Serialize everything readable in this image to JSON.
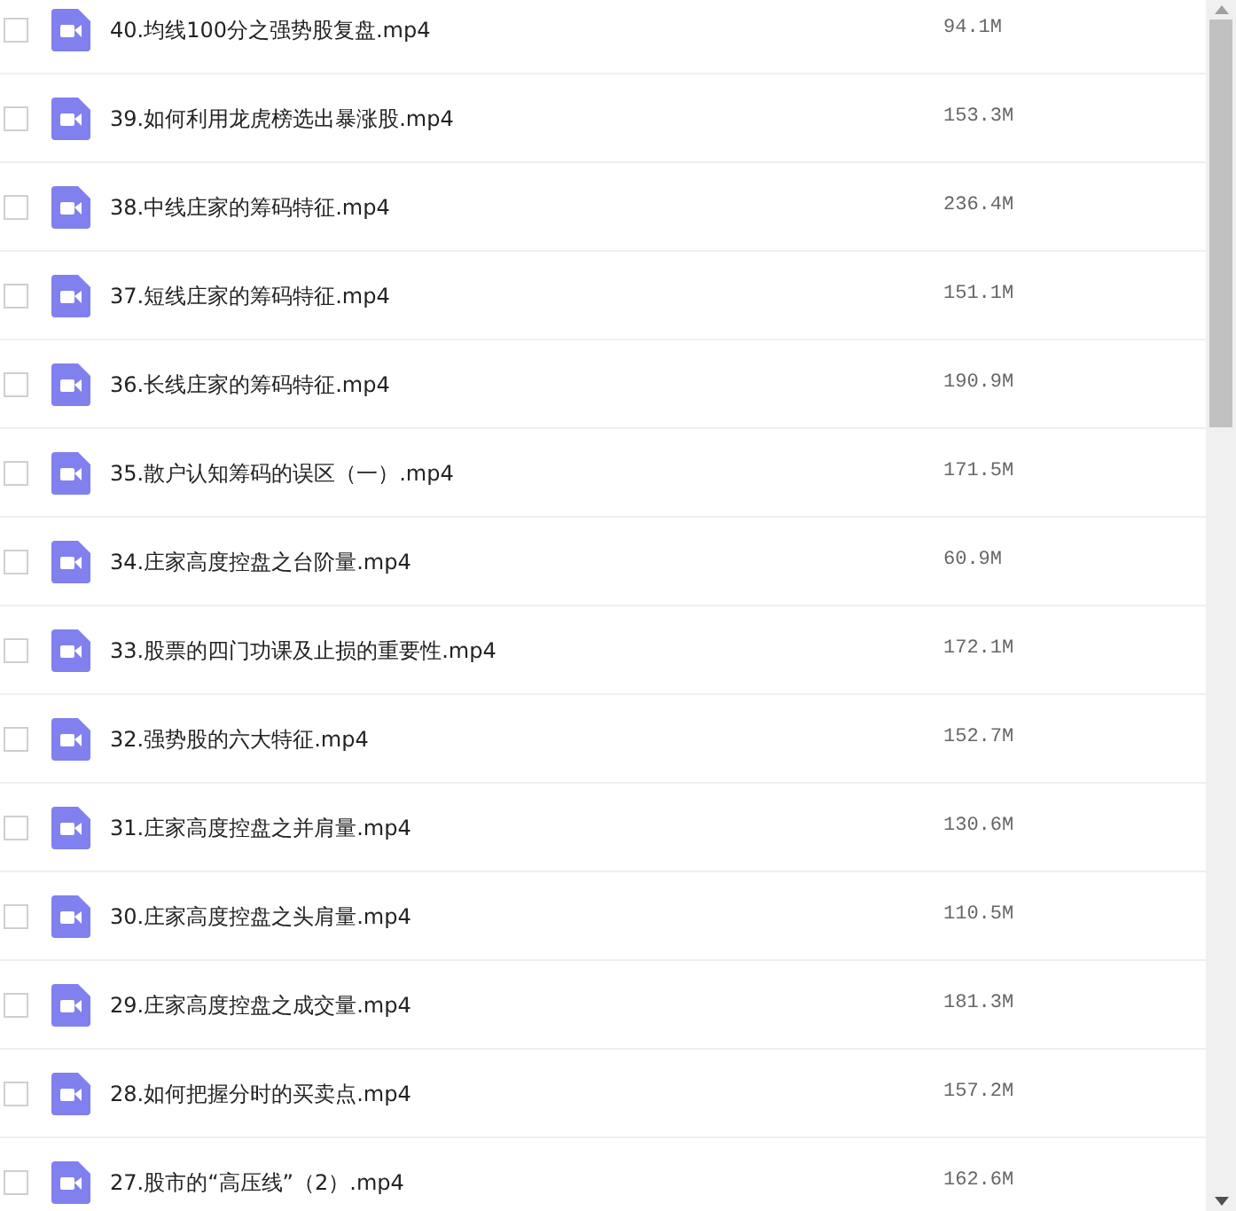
{
  "files": [
    {
      "name": "40.均线100分之强势股复盘.mp4",
      "size": "94.1M",
      "checked": false
    },
    {
      "name": "39.如何利用龙虎榜选出暴涨股.mp4",
      "size": "153.3M",
      "checked": false
    },
    {
      "name": "38.中线庄家的筹码特征.mp4",
      "size": "236.4M",
      "checked": false
    },
    {
      "name": "37.短线庄家的筹码特征.mp4",
      "size": "151.1M",
      "checked": false
    },
    {
      "name": "36.长线庄家的筹码特征.mp4",
      "size": "190.9M",
      "checked": false
    },
    {
      "name": "35.散户认知筹码的误区（一）.mp4",
      "size": "171.5M",
      "checked": false
    },
    {
      "name": "34.庄家高度控盘之台阶量.mp4",
      "size": "60.9M",
      "checked": false
    },
    {
      "name": "33.股票的四门功课及止损的重要性.mp4",
      "size": "172.1M",
      "checked": false
    },
    {
      "name": "32.强势股的六大特征.mp4",
      "size": "152.7M",
      "checked": false
    },
    {
      "name": "31.庄家高度控盘之并肩量.mp4",
      "size": "130.6M",
      "checked": false
    },
    {
      "name": "30.庄家高度控盘之头肩量.mp4",
      "size": "110.5M",
      "checked": false
    },
    {
      "name": "29.庄家高度控盘之成交量.mp4",
      "size": "181.3M",
      "checked": false
    },
    {
      "name": "28.如何把握分时的买卖点.mp4",
      "size": "157.2M",
      "checked": false
    },
    {
      "name": "27.股市的“高压线”（2）.mp4",
      "size": "162.6M",
      "checked": false
    }
  ]
}
